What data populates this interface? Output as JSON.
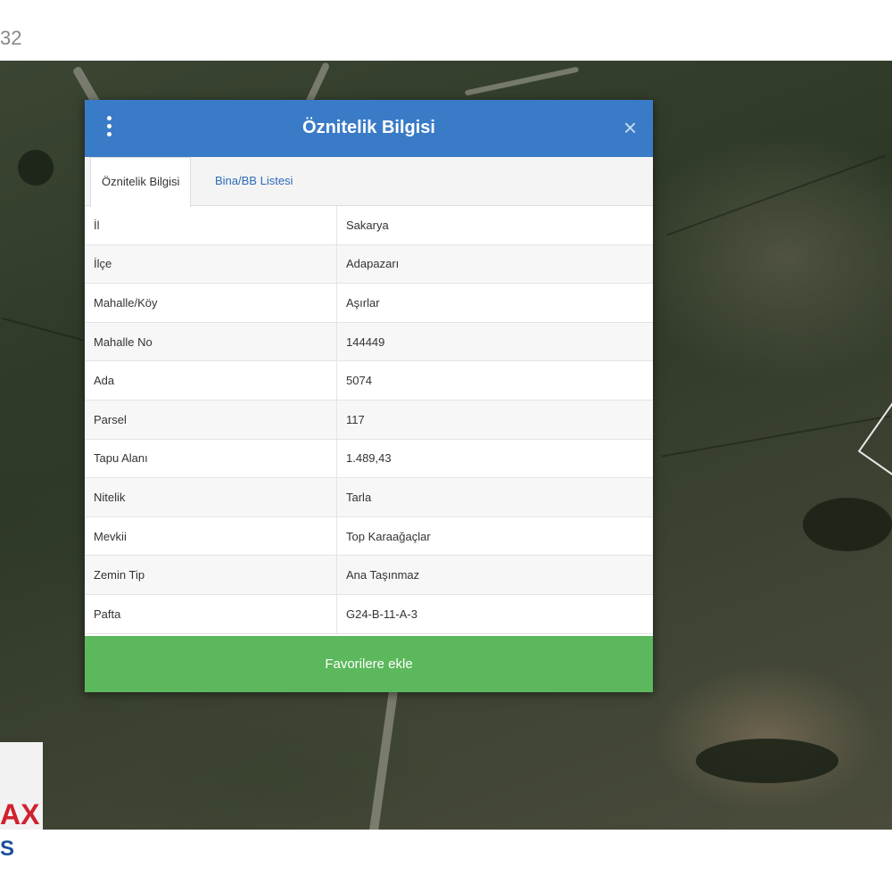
{
  "corner_text": "32",
  "logo": {
    "text": "AX",
    "sub": "S"
  },
  "modal": {
    "title": "Öznitelik Bilgisi",
    "close_symbol": "×",
    "tabs": [
      {
        "label": "Öznitelik Bilgisi",
        "active": true
      },
      {
        "label": "Bina/BB Listesi",
        "active": false
      }
    ],
    "rows": [
      {
        "key": "İl",
        "value": "Sakarya"
      },
      {
        "key": "İlçe",
        "value": "Adapazarı"
      },
      {
        "key": "Mahalle/Köy",
        "value": "Aşırlar"
      },
      {
        "key": "Mahalle No",
        "value": "144449"
      },
      {
        "key": "Ada",
        "value": "5074"
      },
      {
        "key": "Parsel",
        "value": "117"
      },
      {
        "key": "Tapu Alanı",
        "value": "1.489,43"
      },
      {
        "key": "Nitelik",
        "value": "Tarla"
      },
      {
        "key": "Mevkii",
        "value": "Top Karaağaçlar"
      },
      {
        "key": "Zemin Tip",
        "value": "Ana Taşınmaz"
      },
      {
        "key": "Pafta",
        "value": "G24-B-11-A-3"
      }
    ],
    "favorite_button": "Favorilere ekle"
  },
  "icons": {
    "menu": "vertical-dots-icon",
    "close": "close-icon"
  },
  "colors": {
    "header": "#3a7bc8",
    "button": "#5cb85c",
    "tab_link": "#2d6bb8"
  }
}
